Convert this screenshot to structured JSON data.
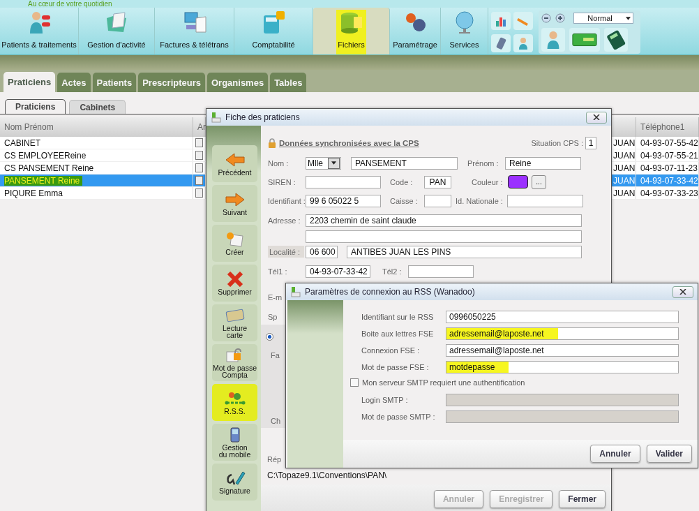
{
  "app": {
    "tagline": "Au cœur de votre quotidien"
  },
  "toolbar": {
    "items": [
      {
        "label": "Patients & traitements",
        "selected": false,
        "highlighted": false
      },
      {
        "label": "Gestion d'activité",
        "selected": false,
        "highlighted": false
      },
      {
        "label": "Factures & télétrans",
        "selected": false,
        "highlighted": false
      },
      {
        "label": "Comptabilité",
        "selected": false,
        "highlighted": false
      },
      {
        "label": "Fichiers",
        "selected": true,
        "highlighted": true
      },
      {
        "label": "Paramétrage",
        "selected": false,
        "highlighted": false
      },
      {
        "label": "Services",
        "selected": false,
        "highlighted": false
      }
    ],
    "zoom": "Normal"
  },
  "tabs": [
    {
      "label": "Praticiens",
      "selected": true
    },
    {
      "label": "Actes",
      "selected": false
    },
    {
      "label": "Patients",
      "selected": false
    },
    {
      "label": "Prescripteurs",
      "selected": false
    },
    {
      "label": "Organismes",
      "selected": false
    },
    {
      "label": "Tables",
      "selected": false
    }
  ],
  "subtabs": [
    {
      "label": "Praticiens",
      "selected": true
    },
    {
      "label": "Cabinets",
      "selected": false
    }
  ],
  "table": {
    "columns": [
      "Nom Prénom",
      "Ar"
    ],
    "column_4": "Téléphone1",
    "rows": [
      {
        "name": "CABINET",
        "column_3": "JUAN",
        "phone": "04-93-07-55-42",
        "selected": false,
        "highlighted": false
      },
      {
        "name": "CS EMPLOYEEReine",
        "column_3": "JUAN",
        "phone": "04-93-07-55-21",
        "selected": false,
        "highlighted": false
      },
      {
        "name": "CS PANSEMENT Reine",
        "column_3": "JUAN",
        "phone": "04-93-07-11-23",
        "selected": false,
        "highlighted": false
      },
      {
        "name": "PANSEMENT Reine",
        "column_3": "JUAN",
        "phone": "04-93-07-33-42",
        "selected": true,
        "highlighted": true
      },
      {
        "name": "PIQURE Emma",
        "column_3": "JUAN",
        "phone": "04-93-07-33-23",
        "selected": false,
        "highlighted": false
      }
    ]
  },
  "fiche": {
    "title": "Fiche des praticiens",
    "sidebar": [
      {
        "label": "Précédent",
        "highlighted": false
      },
      {
        "label": "Suivant",
        "highlighted": false
      },
      {
        "label": "Créer",
        "highlighted": false
      },
      {
        "label": "Supprimer",
        "highlighted": false
      },
      {
        "label": "Lecture\ncarte",
        "highlighted": false
      },
      {
        "label": "Mot de passe\nCompta",
        "highlighted": false
      },
      {
        "label": "R.S.S.",
        "highlighted": true
      },
      {
        "label": "Gestion\ndu mobile",
        "highlighted": false
      },
      {
        "label": "Signature",
        "highlighted": false
      }
    ],
    "heading": "Données synchronisées avec la CPS",
    "situation_label": "Situation CPS :",
    "situation_value": "1",
    "nom_label": "Nom :",
    "civility": "Mlle",
    "nom": "PANSEMENT",
    "prenom_label": "Prénom :",
    "prenom": "Reine",
    "siren_label": "SIREN :",
    "code_label": "Code :",
    "code": "PAN",
    "couleur_label": "Couleur :",
    "couleur_swatch": {
      "color": "#9b30ff"
    },
    "couleur_button": "...",
    "identifiant_label": "Identifiant :",
    "identifiant": "99 6 05022 5",
    "caisse_label": "Caisse :",
    "id_nationale_label": "Id. Nationale :",
    "adresse_label": "Adresse :",
    "adresse": "2203 chemin de saint claude",
    "localite_label": "Localité :",
    "code_postal": "06 600",
    "ville": "ANTIBES JUAN LES PINS",
    "tel1_label": "Tél1 :",
    "tel1": "04-93-07-33-42",
    "tel2_label": "Tél2 :",
    "email_label": "E-m",
    "sp_label": "Sp",
    "radio_checked": true,
    "fa_label": "Fa",
    "ch_label": "Ch",
    "rep_label": "Rép",
    "path": "C:\\Topaze9.1\\Conventions\\PAN\\",
    "buttons": [
      {
        "label": "Annuler",
        "disabled": true
      },
      {
        "label": "Enregistrer",
        "disabled": true
      },
      {
        "label": "Fermer",
        "disabled": false
      }
    ]
  },
  "rss": {
    "title": "Paramètres de connexion au RSS (Wanadoo)",
    "fields": [
      {
        "label": "Identifiant sur le RSS",
        "value": "0996050225",
        "highlighted": false
      },
      {
        "label": "Boite aux lettres FSE",
        "value": "adressemail@laposte.net",
        "highlighted": true
      },
      {
        "label": "Connexion FSE :",
        "value": "adressemail@laposte.net",
        "highlighted": false
      },
      {
        "label": "Mot de passe FSE :",
        "value": "motdepasse",
        "highlighted": true
      }
    ],
    "smtp_auth": {
      "label": "Mon serveur SMTP requiert une authentification",
      "checked": false
    },
    "smtp_fields": [
      {
        "label": "Login SMTP :",
        "disabled": true
      },
      {
        "label": "Mot de passe SMTP :",
        "disabled": true
      }
    ],
    "buttons": [
      "Annuler",
      "Valider"
    ]
  }
}
